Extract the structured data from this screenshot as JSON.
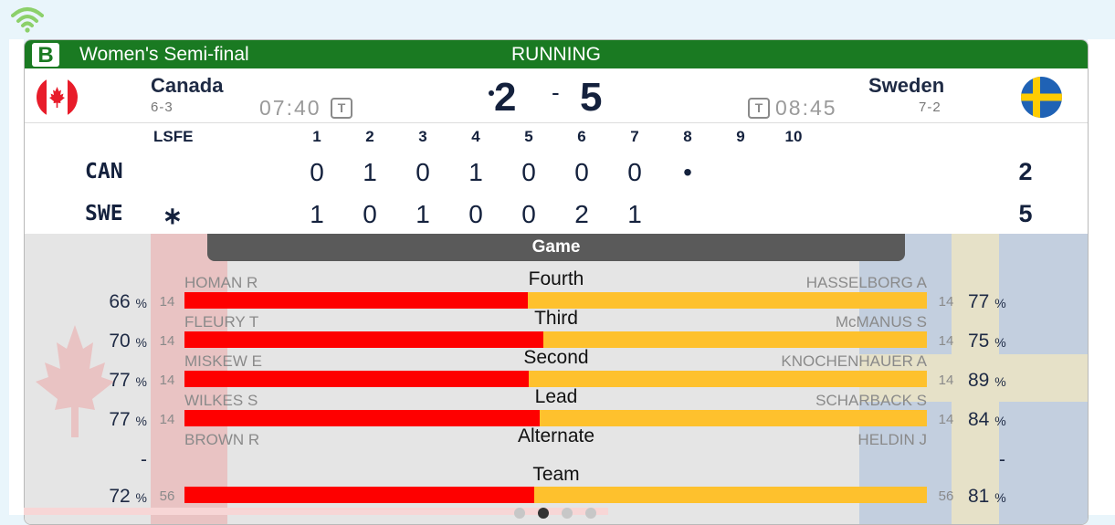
{
  "header": {
    "sheet": "B",
    "event": "Women's Semi-final",
    "status": "RUNNING"
  },
  "colors": {
    "header_bg": "#1a7a22",
    "canada_red": "#fe0000",
    "sweden_yellow": "#fec12d",
    "navy": "#14213d"
  },
  "teams": {
    "home": {
      "name": "Canada",
      "record": "6-3",
      "clock": "07:40",
      "timeout_icon": "T",
      "score": "2",
      "flag_icon": "canada-flag-icon"
    },
    "away": {
      "name": "Sweden",
      "record": "7-2",
      "clock": "08:45",
      "timeout_icon": "T",
      "score": "5",
      "flag_icon": "sweden-flag-icon"
    }
  },
  "score_separator": "-",
  "linescore": {
    "lsfe_label": "LSFE",
    "ends": [
      "1",
      "2",
      "3",
      "4",
      "5",
      "6",
      "7",
      "8",
      "9",
      "10"
    ],
    "rows": [
      {
        "team": "CAN",
        "lsfe": "",
        "scores": [
          "0",
          "1",
          "0",
          "1",
          "0",
          "0",
          "0",
          "•",
          "",
          ""
        ],
        "total": "2"
      },
      {
        "team": "SWE",
        "lsfe": "∗",
        "scores": [
          "1",
          "0",
          "1",
          "0",
          "0",
          "2",
          "1",
          "",
          "",
          ""
        ],
        "total": "5"
      }
    ]
  },
  "stats": {
    "tab": "Game",
    "rows": [
      {
        "position": "Fourth",
        "left_player": "HOMAN R",
        "right_player": "HASSELBORG A",
        "left_pct": "66",
        "right_pct": "77",
        "left_shots": "14",
        "right_shots": "14",
        "left_share": 0.462
      },
      {
        "position": "Third",
        "left_player": "FLEURY T",
        "right_player": "McMANUS S",
        "left_pct": "70",
        "right_pct": "75",
        "left_shots": "14",
        "right_shots": "14",
        "left_share": 0.484
      },
      {
        "position": "Second",
        "left_player": "MISKEW E",
        "right_player": "KNOCHENHAUER A",
        "left_pct": "77",
        "right_pct": "89",
        "left_shots": "14",
        "right_shots": "14",
        "left_share": 0.464
      },
      {
        "position": "Lead",
        "left_player": "WILKES S",
        "right_player": "SCHARBACK S",
        "left_pct": "77",
        "right_pct": "84",
        "left_shots": "14",
        "right_shots": "14",
        "left_share": 0.478
      },
      {
        "position": "Alternate",
        "left_player": "BROWN R",
        "right_player": "HELDIN J",
        "left_pct": "-",
        "right_pct": "-",
        "left_shots": "",
        "right_shots": "",
        "left_share": null
      },
      {
        "position": "Team",
        "left_player": "",
        "right_player": "",
        "left_pct": "72",
        "right_pct": "81",
        "left_shots": "56",
        "right_shots": "56",
        "left_share": 0.471
      }
    ],
    "pct_sign": "%"
  },
  "pager": {
    "pages": 4,
    "active": 1
  }
}
